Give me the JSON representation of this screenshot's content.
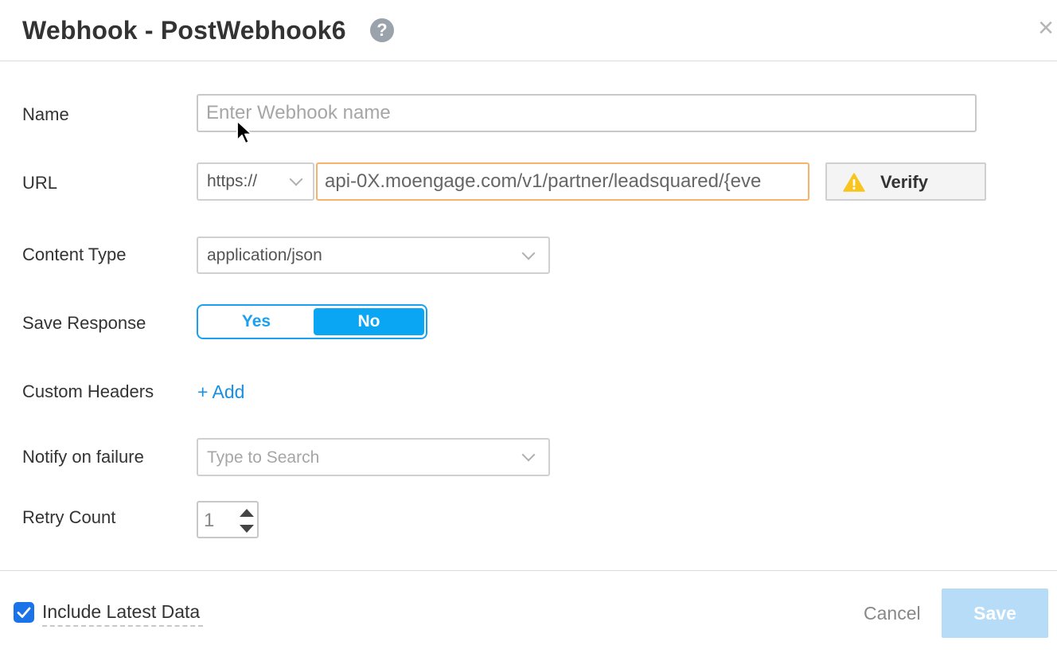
{
  "dialog": {
    "title": "Webhook - PostWebhook6",
    "help_icon": "?",
    "close_icon": "×"
  },
  "form": {
    "name": {
      "label": "Name",
      "placeholder": "Enter Webhook name",
      "value": ""
    },
    "url": {
      "label": "URL",
      "protocol": "https://",
      "value": "api-0X.moengage.com/v1/partner/leadsquared/{eve",
      "verify_label": "Verify",
      "verify_icon": "warning-icon"
    },
    "content_type": {
      "label": "Content Type",
      "value": "application/json"
    },
    "save_response": {
      "label": "Save Response",
      "yes_label": "Yes",
      "no_label": "No",
      "selected": "No"
    },
    "custom_headers": {
      "label": "Custom Headers",
      "add_label": "+ Add"
    },
    "notify_on_failure": {
      "label": "Notify on failure",
      "placeholder": "Type to Search"
    },
    "retry_count": {
      "label": "Retry Count",
      "value": "1"
    }
  },
  "footer": {
    "include_latest_data_label": "Include Latest Data",
    "include_latest_data_checked": true,
    "cancel_label": "Cancel",
    "save_label": "Save"
  },
  "colors": {
    "accent": "#0aa6f4",
    "link": "#1a8fe3",
    "url_border": "#f5b36b",
    "save_disabled": "#b7dcf7",
    "checkbox": "#1a73e8"
  }
}
